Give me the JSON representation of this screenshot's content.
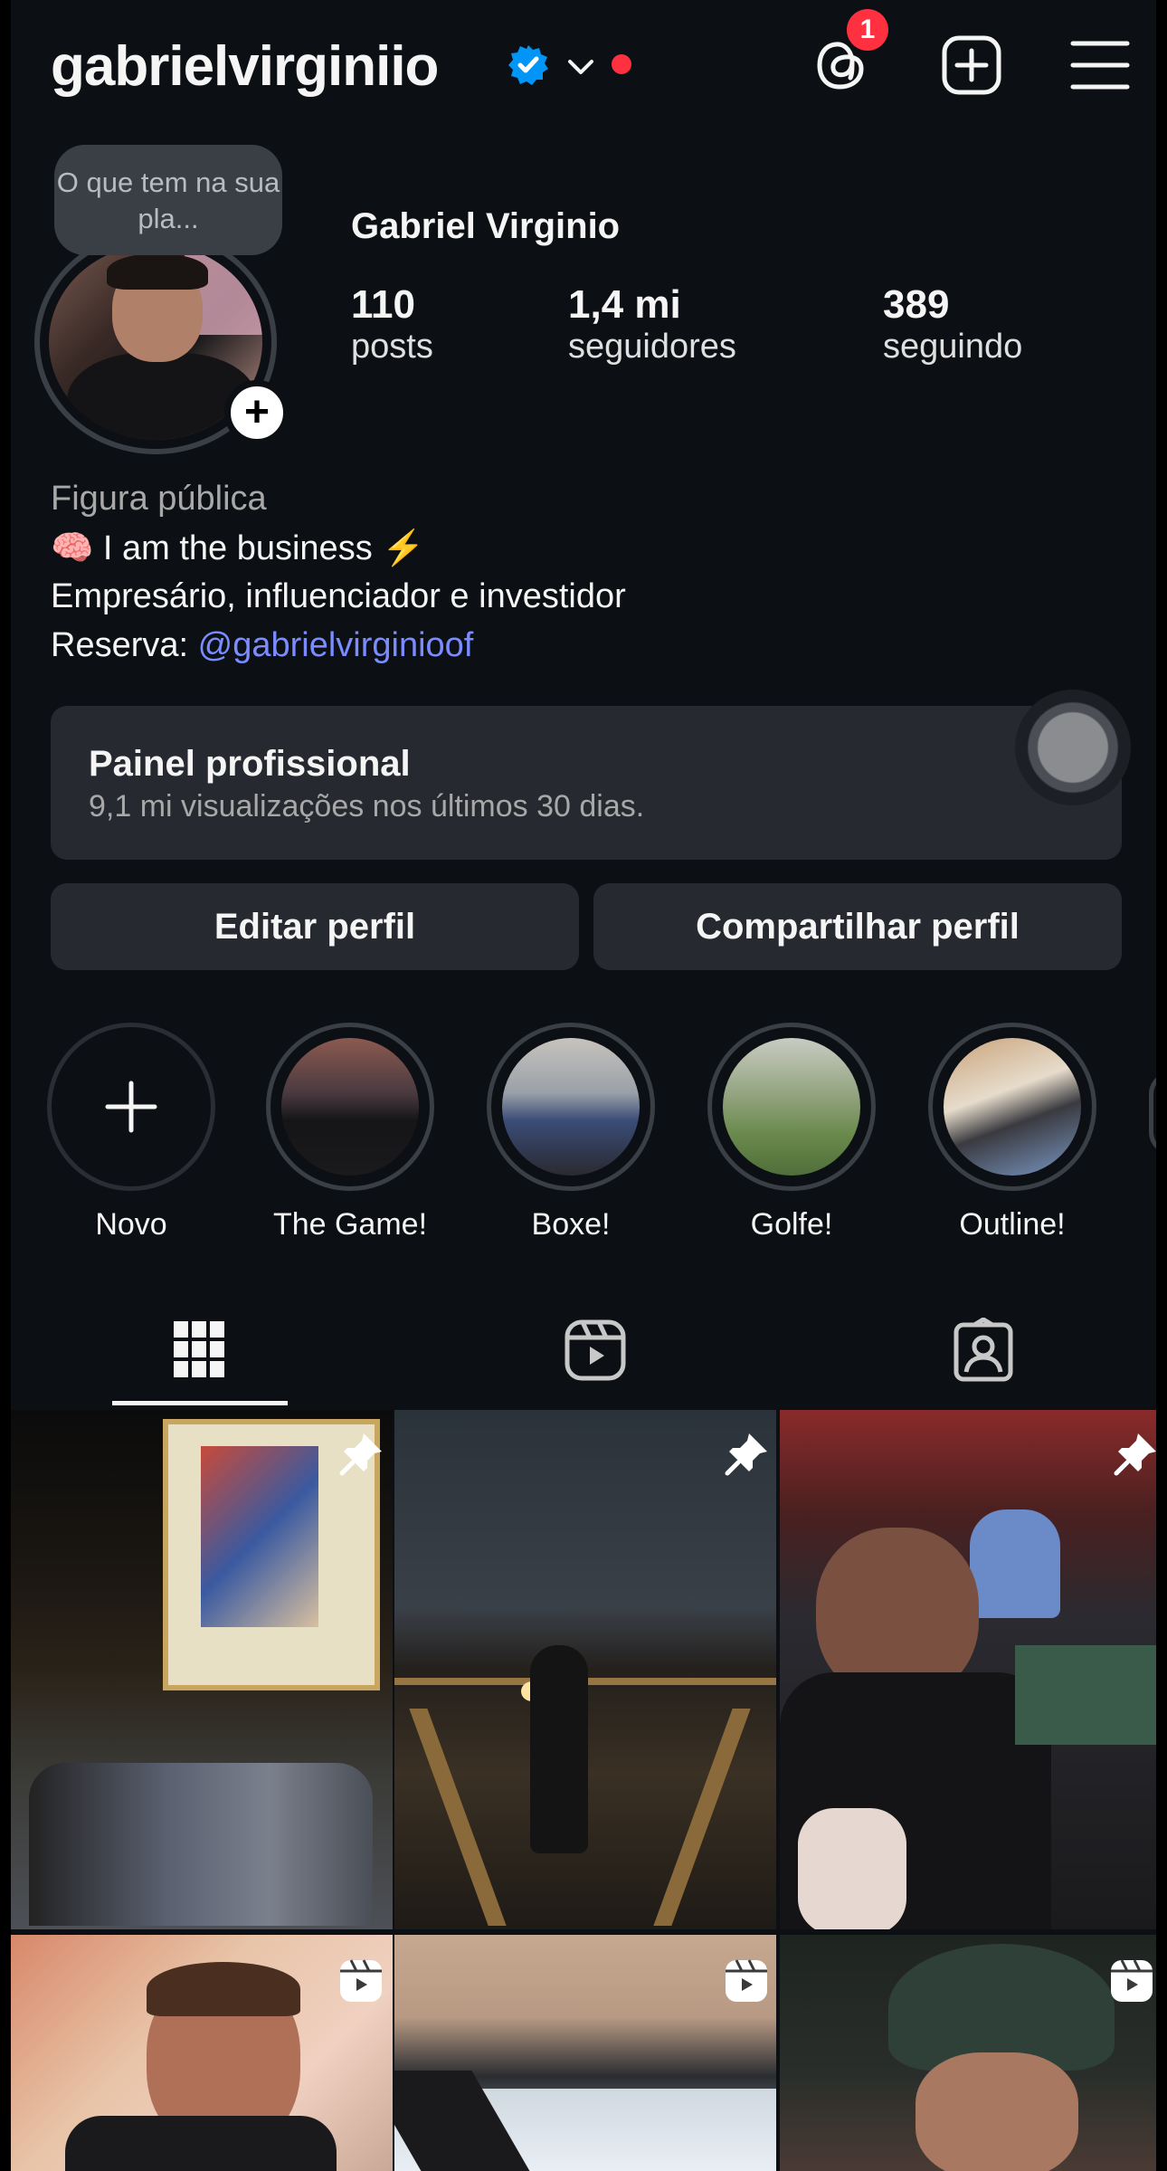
{
  "header": {
    "username": "gabrielvirginiio",
    "threads_badge": "1"
  },
  "profile": {
    "note": "O que tem na sua pla...",
    "full_name": "Gabriel Virginio",
    "stats": [
      {
        "value": "110",
        "label": "posts"
      },
      {
        "value": "1,4 mi",
        "label": "seguidores"
      },
      {
        "value": "389",
        "label": "seguindo"
      }
    ],
    "category": "Figura pública",
    "bio_line1": "🧠 I am the business ⚡",
    "bio_line2": "Empresário, influenciador e investidor",
    "bio_reserve_label": "Reserva: ",
    "bio_reserve_link": "@gabrielvirginioof"
  },
  "dashboard": {
    "title": "Painel profissional",
    "subtitle": "9,1 mi visualizações nos últimos 30 dias."
  },
  "actions": {
    "edit": "Editar perfil",
    "share": "Compartilhar perfil"
  },
  "highlights": [
    {
      "label": "Novo"
    },
    {
      "label": "The Game!"
    },
    {
      "label": "Boxe!"
    },
    {
      "label": "Golfe!"
    },
    {
      "label": "Outline!"
    }
  ],
  "icons": {
    "verified": "verified-badge-icon",
    "threads": "threads-icon",
    "create": "plus-square-icon",
    "menu": "hamburger-menu-icon",
    "grid_tab": "grid-icon",
    "reels_tab": "reels-icon",
    "tagged_tab": "tagged-icon",
    "pinned": "pin-icon",
    "reel": "reel-icon"
  },
  "colors": {
    "background": "#0c1014",
    "surface": "#26292f",
    "verified": "#0095f6",
    "badge": "#ff3040",
    "link": "#7a8cff"
  }
}
